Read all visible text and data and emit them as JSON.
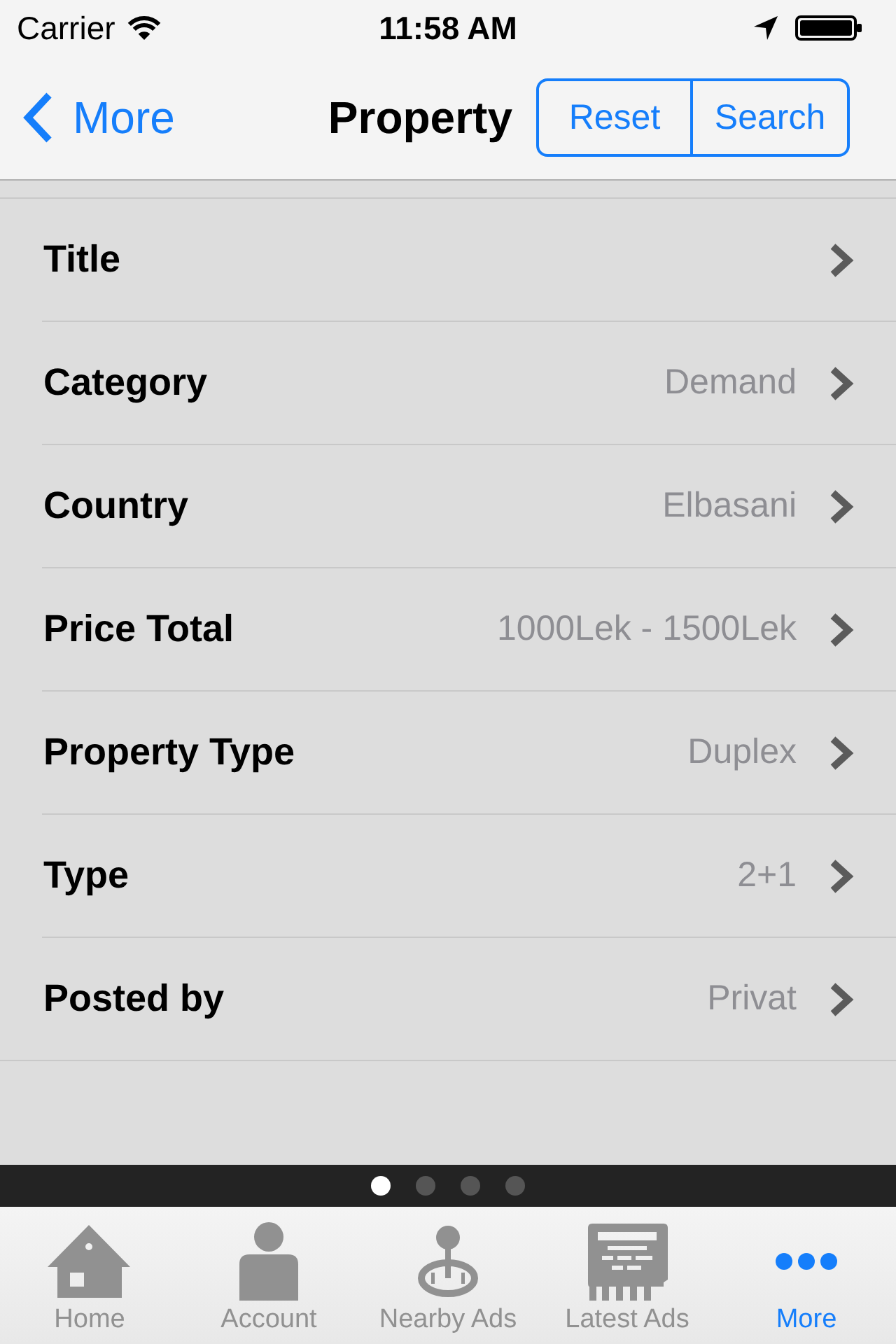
{
  "status_bar": {
    "carrier": "Carrier",
    "time": "11:58 AM"
  },
  "nav_bar": {
    "back": "More",
    "title": "Property",
    "buttons": [
      "Reset",
      "Search"
    ]
  },
  "rows": [
    {
      "label": "Title"
    },
    {
      "label": "Category",
      "value": "Demand"
    },
    {
      "label": "Country",
      "value": "Elbasani"
    },
    {
      "label": "Price Total",
      "value": "1000Lek - 1500Lek"
    },
    {
      "label": "Property Type",
      "value": "Duplex"
    },
    {
      "label": "Type",
      "value": "2+1"
    },
    {
      "label": "Posted by",
      "value": "Privat"
    }
  ],
  "page_indicator": [
    {
      "selected": true
    },
    {
      "selected": false
    },
    {
      "selected": false
    },
    {
      "selected": false
    }
  ],
  "tab_bar": [
    {
      "label": "Home",
      "selected": false
    },
    {
      "label": "Account",
      "selected": false
    },
    {
      "label": "Nearby Ads",
      "selected": false
    },
    {
      "label": "Latest Ads",
      "selected": false
    },
    {
      "label": "More",
      "selected": true
    }
  ]
}
